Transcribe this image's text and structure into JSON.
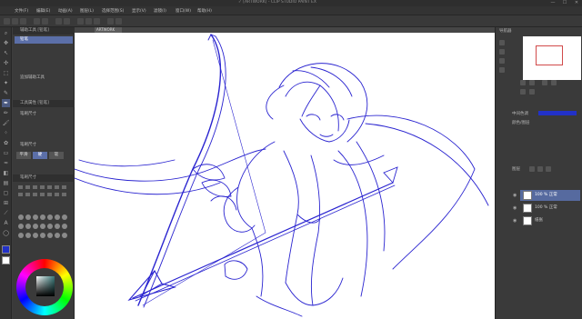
{
  "window": {
    "title": "✓ [ARTWORK] - CLIP STUDIO PAINT EX",
    "controls": [
      "—",
      "☐",
      "✕"
    ]
  },
  "menubar": {
    "items": [
      "文件(F)",
      "编辑(E)",
      "动画(A)",
      "图层(L)",
      "选择范围(S)",
      "显示(V)",
      "滤镜(I)",
      "窗口(W)",
      "帮助(H)"
    ]
  },
  "canvas": {
    "tab_label": "ARTWORK",
    "line_color": "#2a24d0"
  },
  "subtool": {
    "header": "辅助工具 [铅笔]",
    "selected": "铅笔",
    "add_label": "追加辅助工具",
    "detail_header": "工具属性 [铅笔]",
    "detail_row1": "笔刷尺寸",
    "detail_row2": "笔刷尺寸",
    "toggle_a": "平滑",
    "toggle_b": "硬",
    "toggle_c": "软",
    "palette_header": "笔刷尺寸"
  },
  "right": {
    "nav_header": "导航器",
    "color_label": "中间色调",
    "opacity_label": "颜色/图层",
    "layer_header": "图层",
    "layers": [
      {
        "name": "100 % 正常",
        "sub": "线稿"
      },
      {
        "name": "100 % 正常",
        "sub": "图层 1"
      },
      {
        "name": "纸张",
        "sub": ""
      }
    ]
  },
  "colors": {
    "accent": "#5b6fa8",
    "ui_bg": "#3a3a3a",
    "line_blue": "#2231c8"
  }
}
